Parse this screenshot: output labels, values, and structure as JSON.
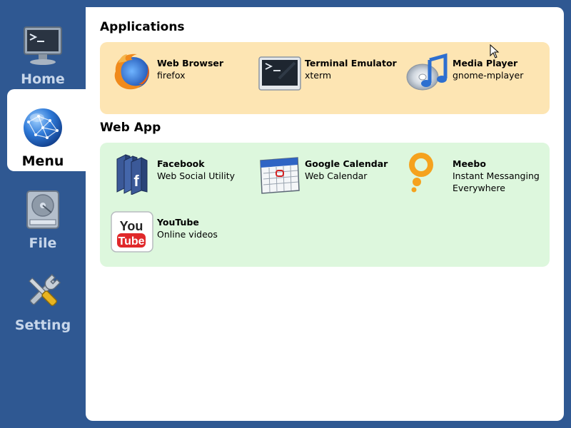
{
  "sidebar": {
    "items": [
      {
        "label": "Home",
        "icon": "monitor-icon"
      },
      {
        "label": "Menu",
        "icon": "globe-icon"
      },
      {
        "label": "File",
        "icon": "hard-drive-icon"
      },
      {
        "label": "Setting",
        "icon": "tools-icon"
      }
    ],
    "active": "Menu"
  },
  "sections": {
    "applications": {
      "title": "Applications",
      "items": [
        {
          "name": "Web Browser",
          "desc": "firefox",
          "icon": "firefox-icon"
        },
        {
          "name": "Terminal Emulator",
          "desc": "xterm",
          "icon": "terminal-icon"
        },
        {
          "name": "Media Player",
          "desc": "gnome-mplayer",
          "icon": "media-player-icon"
        }
      ]
    },
    "webapp": {
      "title": "Web App",
      "items": [
        {
          "name": "Facebook",
          "desc": "Web Social Utility",
          "icon": "facebook-icon"
        },
        {
          "name": "Google Calendar",
          "desc": "Web Calendar",
          "icon": "calendar-icon"
        },
        {
          "name": "Meebo",
          "desc": "Instant Messanging",
          "desc2": "Everywhere",
          "icon": "meebo-icon"
        },
        {
          "name": "YouTube",
          "desc": "Online videos",
          "icon": "youtube-icon"
        }
      ]
    }
  },
  "colors": {
    "background": "#2f5892",
    "applications_panel": "#fde5b3",
    "webapp_panel": "#ddf7dd"
  }
}
